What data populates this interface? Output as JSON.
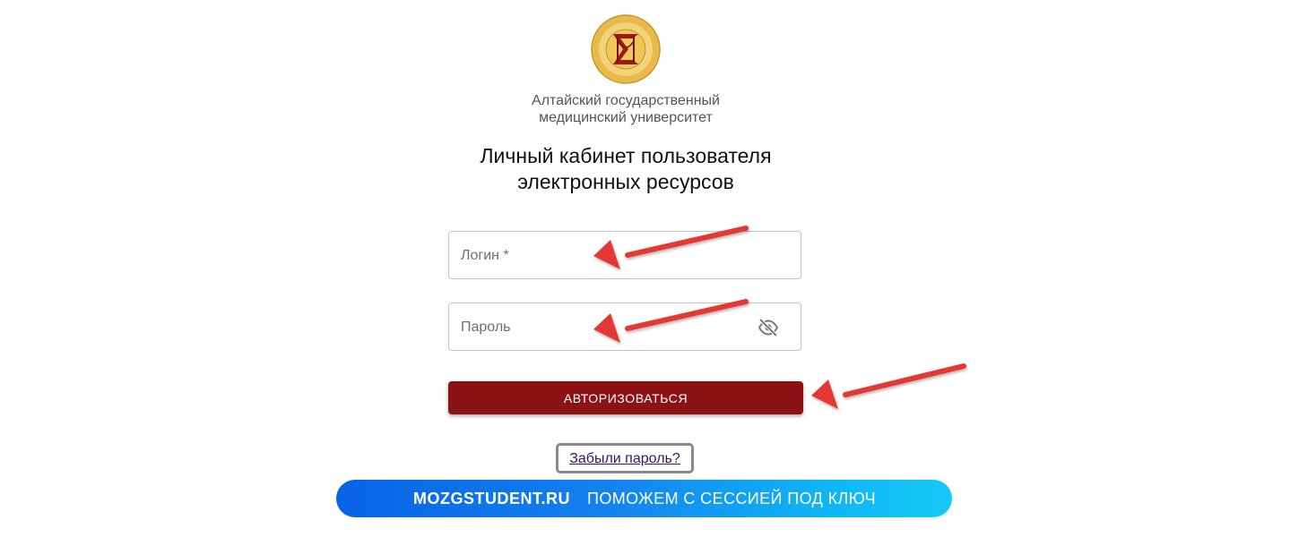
{
  "university": {
    "name_line1": "Алтайский государственный",
    "name_line2": "медицинский университет",
    "logo_icon": "university-seal-icon"
  },
  "heading": {
    "line1": "Личный кабинет пользователя",
    "line2": "электронных ресурсов"
  },
  "form": {
    "login_label": "Логин *",
    "login_value": "",
    "password_label": "Пароль",
    "password_value": "",
    "password_toggle_icon": "eye-off-icon",
    "submit_label": "Авторизоваться",
    "forgot_label": "Забыли пароль?"
  },
  "promo": {
    "site": "MOZGSTUDENT.RU",
    "slogan": "ПОМОЖЕМ С СЕССИЕЙ ПОД КЛЮЧ"
  },
  "colors": {
    "primary_button": "#8b1215",
    "annotation_arrow": "#e53935",
    "promo_gradient_start": "#0862e6",
    "promo_gradient_end": "#16c9f7",
    "link": "#3c1666"
  }
}
